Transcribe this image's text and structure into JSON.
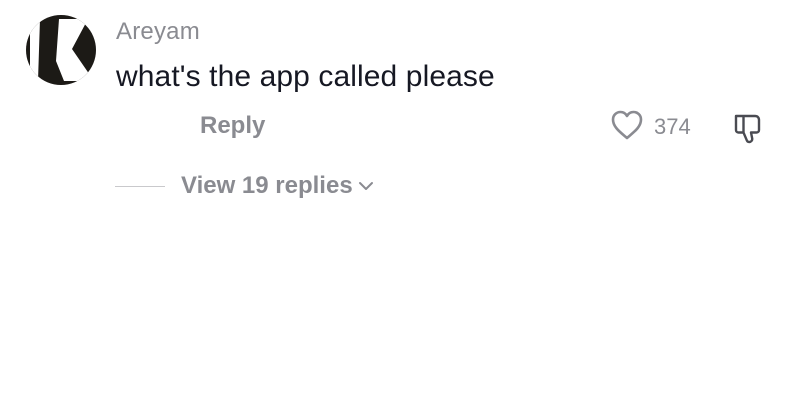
{
  "comment": {
    "username": "Areyam",
    "text": "what's the app called please",
    "reply_label": "Reply",
    "like_count": "374",
    "view_replies_label": "View 19 replies"
  },
  "icons": {
    "avatar": "profile-avatar-letter-k",
    "like": "heart-outline-icon",
    "dislike": "thumbs-down-icon",
    "expand": "chevron-down-icon"
  },
  "colors": {
    "primary_text": "#161823",
    "secondary_text": "#8a8b91",
    "avatar_bg": "#1c1a16"
  }
}
